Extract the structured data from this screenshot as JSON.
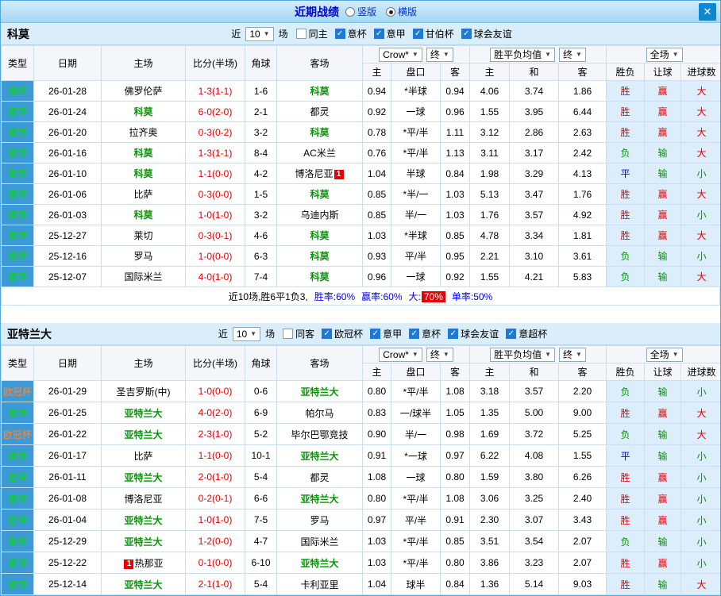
{
  "titlebar": {
    "title": "近期战绩",
    "radios": [
      {
        "label": "竖版",
        "checked": false
      },
      {
        "label": "横版",
        "checked": true
      }
    ]
  },
  "icons": {
    "chevron_down": "▼",
    "close": "✕",
    "check": "✓"
  },
  "table_headers": {
    "type": "类型",
    "date": "日期",
    "home": "主场",
    "score": "比分(半场)",
    "corner": "角球",
    "away": "客场",
    "odds_source": "Crow*",
    "odds_period": "终",
    "avg_label": "胜平负均值",
    "avg_period": "终",
    "scope": "全场",
    "sub_home": "主",
    "sub_handicap": "盘口",
    "sub_away": "客",
    "sub_home2": "主",
    "sub_draw": "和",
    "sub_away2": "客",
    "sub_wdl": "胜负",
    "sub_hc_result": "让球",
    "sub_goals": "进球数"
  },
  "colors": {
    "type_column_blue": "#3d9ad6",
    "win_red": "#e60000",
    "draw_blue": "#0000ee",
    "lose_green": "#009900",
    "league_green": "#00dd00",
    "league_orange": "#ff8833"
  },
  "sections": [
    {
      "team": "科莫",
      "near_label": "近",
      "near_value": "10",
      "unit_label": "场",
      "filters": [
        {
          "label": "同主",
          "checked": false
        },
        {
          "label": "意杯",
          "checked": true
        },
        {
          "label": "意甲",
          "checked": true
        },
        {
          "label": "甘伯杯",
          "checked": true
        },
        {
          "label": "球会友谊",
          "checked": true
        }
      ],
      "rows": [
        [
          "意杯",
          "26-01-28",
          "佛罗伦萨",
          "1-3(1-1)",
          "1-6",
          "科莫",
          "0.94",
          "*半球",
          "0.94",
          "4.06",
          "3.74",
          "1.86",
          "胜",
          "赢",
          "大"
        ],
        [
          "意甲",
          "26-01-24",
          "科莫",
          "6-0(2-0)",
          "2-1",
          "都灵",
          "0.92",
          "一球",
          "0.96",
          "1.55",
          "3.95",
          "6.44",
          "胜",
          "赢",
          "大"
        ],
        [
          "意甲",
          "26-01-20",
          "拉齐奥",
          "0-3(0-2)",
          "3-2",
          "科莫",
          "0.78",
          "*平/半",
          "1.11",
          "3.12",
          "2.86",
          "2.63",
          "胜",
          "赢",
          "大"
        ],
        [
          "意甲",
          "26-01-16",
          "科莫",
          "1-3(1-1)",
          "8-4",
          "AC米兰",
          "0.76",
          "*平/半",
          "1.13",
          "3.11",
          "3.17",
          "2.42",
          "负",
          "输",
          "大"
        ],
        [
          "意甲",
          "26-01-10",
          "科莫",
          "1-1(0-0)",
          "4-2",
          "博洛尼亚{1}",
          "1.04",
          "半球",
          "0.84",
          "1.98",
          "3.29",
          "4.13",
          "平",
          "输",
          "小"
        ],
        [
          "意甲",
          "26-01-06",
          "比萨",
          "0-3(0-0)",
          "1-5",
          "科莫",
          "0.85",
          "*半/一",
          "1.03",
          "5.13",
          "3.47",
          "1.76",
          "胜",
          "赢",
          "大"
        ],
        [
          "意甲",
          "26-01-03",
          "科莫",
          "1-0(1-0)",
          "3-2",
          "乌迪内斯",
          "0.85",
          "半/一",
          "1.03",
          "1.76",
          "3.57",
          "4.92",
          "胜",
          "赢",
          "小"
        ],
        [
          "意甲",
          "25-12-27",
          "莱切",
          "0-3(0-1)",
          "4-6",
          "科莫",
          "1.03",
          "*半球",
          "0.85",
          "4.78",
          "3.34",
          "1.81",
          "胜",
          "赢",
          "大"
        ],
        [
          "意甲",
          "25-12-16",
          "罗马",
          "1-0(0-0)",
          "6-3",
          "科莫",
          "0.93",
          "平/半",
          "0.95",
          "2.21",
          "3.10",
          "3.61",
          "负",
          "输",
          "小"
        ],
        [
          "意甲",
          "25-12-07",
          "国际米兰",
          "4-0(1-0)",
          "7-4",
          "科莫",
          "0.96",
          "一球",
          "0.92",
          "1.55",
          "4.21",
          "5.83",
          "负",
          "输",
          "大"
        ]
      ],
      "summary": {
        "prefix": "近10场,胜6平1负3,",
        "items": [
          {
            "label": "胜率:",
            "value": "60%",
            "highlight": false
          },
          {
            "label": "赢率:",
            "value": "60%",
            "highlight": false
          },
          {
            "label": "大:",
            "value": "70%",
            "highlight": true
          },
          {
            "label": "单率:",
            "value": "50%",
            "highlight": false
          }
        ]
      }
    },
    {
      "team": "亚特兰大",
      "near_label": "近",
      "near_value": "10",
      "unit_label": "场",
      "filters": [
        {
          "label": "同客",
          "checked": false
        },
        {
          "label": "欧冠杯",
          "checked": true
        },
        {
          "label": "意甲",
          "checked": true
        },
        {
          "label": "意杯",
          "checked": true
        },
        {
          "label": "球会友谊",
          "checked": true
        },
        {
          "label": "意超杯",
          "checked": true
        }
      ],
      "rows": [
        [
          "欧冠杯",
          "26-01-29",
          "圣吉罗斯(中)",
          "1-0(0-0)",
          "0-6",
          "亚特兰大",
          "0.80",
          "*平/半",
          "1.08",
          "3.18",
          "3.57",
          "2.20",
          "负",
          "输",
          "小"
        ],
        [
          "意甲",
          "26-01-25",
          "亚特兰大",
          "4-0(2-0)",
          "6-9",
          "帕尔马",
          "0.83",
          "一/球半",
          "1.05",
          "1.35",
          "5.00",
          "9.00",
          "胜",
          "赢",
          "大"
        ],
        [
          "欧冠杯",
          "26-01-22",
          "亚特兰大",
          "2-3(1-0)",
          "5-2",
          "毕尔巴鄂竞技",
          "0.90",
          "半/一",
          "0.98",
          "1.69",
          "3.72",
          "5.25",
          "负",
          "输",
          "大"
        ],
        [
          "意甲",
          "26-01-17",
          "比萨",
          "1-1(0-0)",
          "10-1",
          "亚特兰大",
          "0.91",
          "*一球",
          "0.97",
          "6.22",
          "4.08",
          "1.55",
          "平",
          "输",
          "小"
        ],
        [
          "意甲",
          "26-01-11",
          "亚特兰大",
          "2-0(1-0)",
          "5-4",
          "都灵",
          "1.08",
          "一球",
          "0.80",
          "1.59",
          "3.80",
          "6.26",
          "胜",
          "赢",
          "小"
        ],
        [
          "意甲",
          "26-01-08",
          "博洛尼亚",
          "0-2(0-1)",
          "6-6",
          "亚特兰大",
          "0.80",
          "*平/半",
          "1.08",
          "3.06",
          "3.25",
          "2.40",
          "胜",
          "赢",
          "小"
        ],
        [
          "意甲",
          "26-01-04",
          "亚特兰大",
          "1-0(1-0)",
          "7-5",
          "罗马",
          "0.97",
          "平/半",
          "0.91",
          "2.30",
          "3.07",
          "3.43",
          "胜",
          "赢",
          "小"
        ],
        [
          "意甲",
          "25-12-29",
          "亚特兰大",
          "1-2(0-0)",
          "4-7",
          "国际米兰",
          "1.03",
          "*平/半",
          "0.85",
          "3.51",
          "3.54",
          "2.07",
          "负",
          "输",
          "小"
        ],
        [
          "意甲",
          "25-12-22",
          "{1}热那亚",
          "0-1(0-0)",
          "6-10",
          "亚特兰大",
          "1.03",
          "*平/半",
          "0.80",
          "3.86",
          "3.23",
          "2.07",
          "胜",
          "赢",
          "小"
        ],
        [
          "意甲",
          "25-12-14",
          "亚特兰大",
          "2-1(1-0)",
          "5-4",
          "卡利亚里",
          "1.04",
          "球半",
          "0.84",
          "1.36",
          "5.14",
          "9.03",
          "胜",
          "输",
          "大"
        ]
      ],
      "summary": null
    }
  ]
}
